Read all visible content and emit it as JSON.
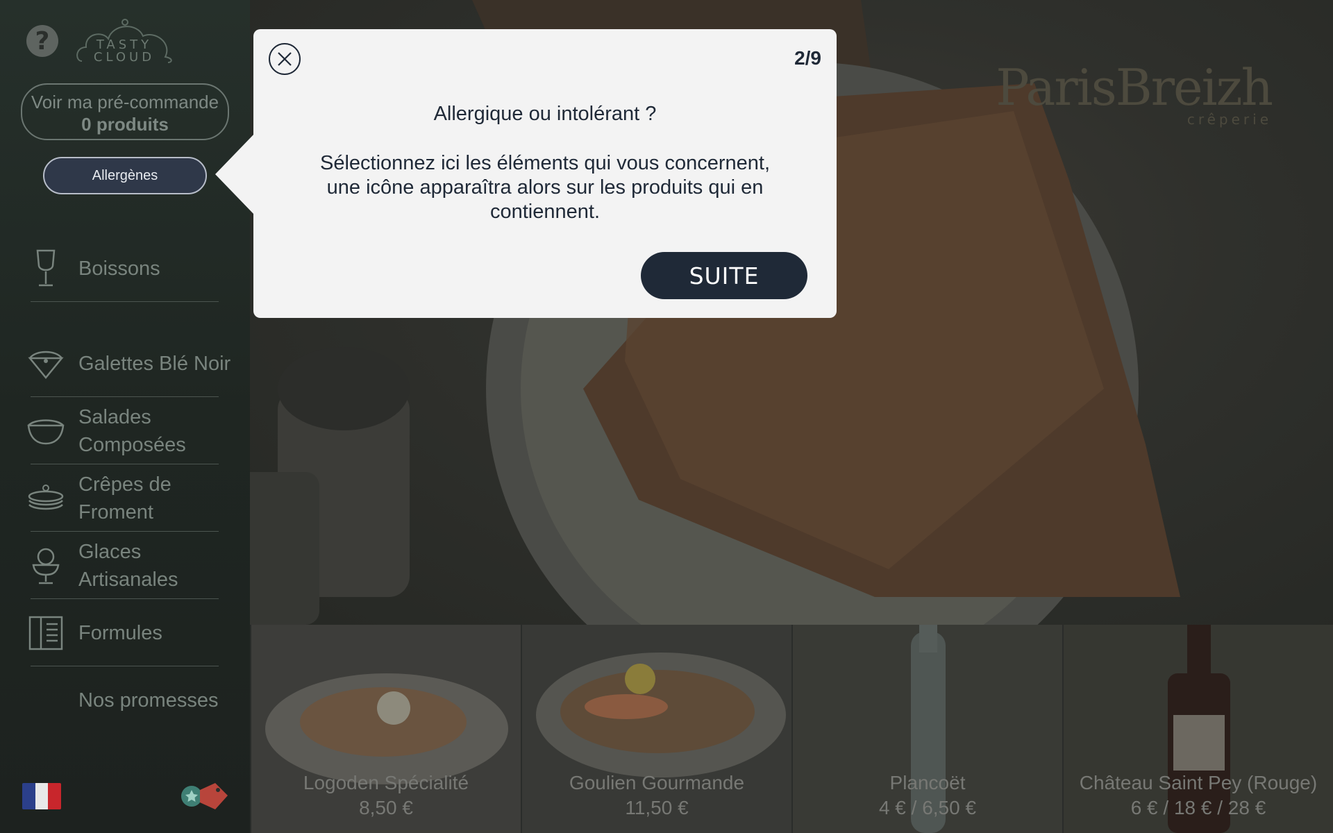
{
  "sidebar": {
    "help_icon": "?",
    "logo": {
      "line1": "TASTY",
      "line2": "CLOUD"
    },
    "preorder": {
      "line1": "Voir ma pré-commande",
      "line2": "0 produits"
    },
    "allergens_button": "Allergènes",
    "menu": [
      {
        "label": "Boissons",
        "icon": "wine-glass-icon"
      },
      {
        "label": "Galettes Blé Noir",
        "icon": "galette-icon"
      },
      {
        "label": "Salades Composées",
        "icon": "salad-bowl-icon"
      },
      {
        "label": "Crêpes de Froment",
        "icon": "crepe-stack-icon"
      },
      {
        "label": "Glaces Artisanales",
        "icon": "ice-cream-icon"
      },
      {
        "label": "Formules",
        "icon": "menu-book-icon"
      },
      {
        "label": "Nos promesses",
        "icon": ""
      }
    ],
    "language_flag": "france-flag",
    "tags_icon": "loyalty-tags-icon"
  },
  "hero": {
    "brand_name": "ParisBreizh",
    "brand_sub": "crêperie"
  },
  "products": [
    {
      "name": "Logoden Spécialité",
      "price": "8,50 €"
    },
    {
      "name": "Goulien Gourmande",
      "price": "11,50 €"
    },
    {
      "name": "Plancoët",
      "price": "4 € / 6,50 €"
    },
    {
      "name": "Château Saint Pey (Rouge)",
      "price": "6 € / 18 € / 28 €"
    }
  ],
  "modal": {
    "step": "2/9",
    "title": "Allergique ou intolérant ?",
    "body": "Sélectionnez ici les éléments qui vous concernent, une icône apparaîtra alors sur les produits qui en contiennent.",
    "next_button": "SUITE"
  },
  "colors": {
    "modal_bg": "#f3f3f3",
    "primary_dark": "#1f2937",
    "sidebar_bg": "#1f2622"
  }
}
